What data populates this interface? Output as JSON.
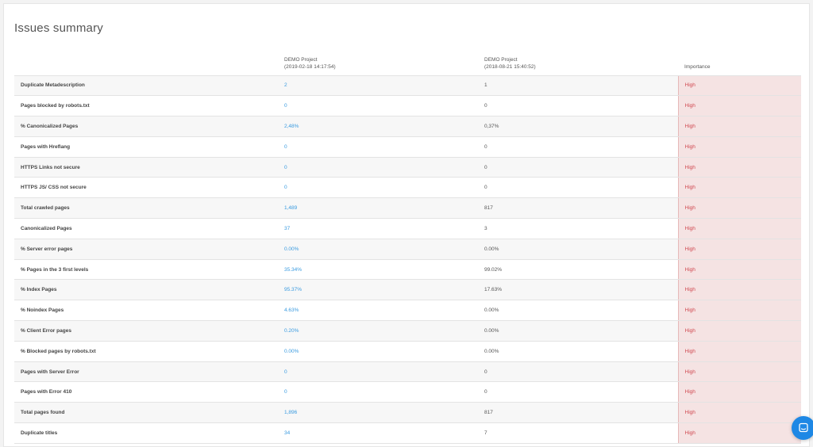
{
  "page": {
    "title": "Issues summary"
  },
  "columns": {
    "a_name": "DEMO Project",
    "a_date": "(2019-02-18 14:17:54)",
    "b_name": "DEMO Project",
    "b_date": "(2018-08-21 15:40:52)",
    "importance": "Importance"
  },
  "rows": [
    {
      "label": "Duplicate Metadescription",
      "a": "2",
      "b": "1",
      "importance": "High"
    },
    {
      "label": "Pages blocked by robots.txt",
      "a": "0",
      "b": "0",
      "importance": "High"
    },
    {
      "label": "% Canonicalized Pages",
      "a": "2,48%",
      "b": "0,37%",
      "importance": "High"
    },
    {
      "label": "Pages with Hreflang",
      "a": "0",
      "b": "0",
      "importance": "High"
    },
    {
      "label": "HTTPS Links not secure",
      "a": "0",
      "b": "0",
      "importance": "High"
    },
    {
      "label": "HTTPS JS/ CSS not secure",
      "a": "0",
      "b": "0",
      "importance": "High"
    },
    {
      "label": "Total crawled pages",
      "a": "1,489",
      "b": "817",
      "importance": "High"
    },
    {
      "label": "Canonicalized Pages",
      "a": "37",
      "b": "3",
      "importance": "High"
    },
    {
      "label": "% Server error pages",
      "a": "0.00%",
      "b": "0.00%",
      "importance": "High"
    },
    {
      "label": "% Pages in the 3 first levels",
      "a": "35.34%",
      "b": "99.02%",
      "importance": "High"
    },
    {
      "label": "% Index Pages",
      "a": "95.37%",
      "b": "17.63%",
      "importance": "High"
    },
    {
      "label": "% Noindex Pages",
      "a": "4.63%",
      "b": "0.00%",
      "importance": "High"
    },
    {
      "label": "% Client Error pages",
      "a": "0.20%",
      "b": "0.00%",
      "importance": "High"
    },
    {
      "label": "% Blocked pages by robots.txt",
      "a": "0.00%",
      "b": "0.00%",
      "importance": "High"
    },
    {
      "label": "Pages with Server Error",
      "a": "0",
      "b": "0",
      "importance": "High"
    },
    {
      "label": "Pages with Error 410",
      "a": "0",
      "b": "0",
      "importance": "High"
    },
    {
      "label": "Total pages found",
      "a": "1,896",
      "b": "817",
      "importance": "High"
    },
    {
      "label": "Duplicate titles",
      "a": "34",
      "b": "7",
      "importance": "High"
    }
  ],
  "colors": {
    "link": "#3a9be0",
    "importance_bg": "#f5e3e3",
    "importance_text": "#d0474f",
    "chat_button": "#1e88e5"
  },
  "icons": {
    "chat": "chat-bubble-icon"
  }
}
